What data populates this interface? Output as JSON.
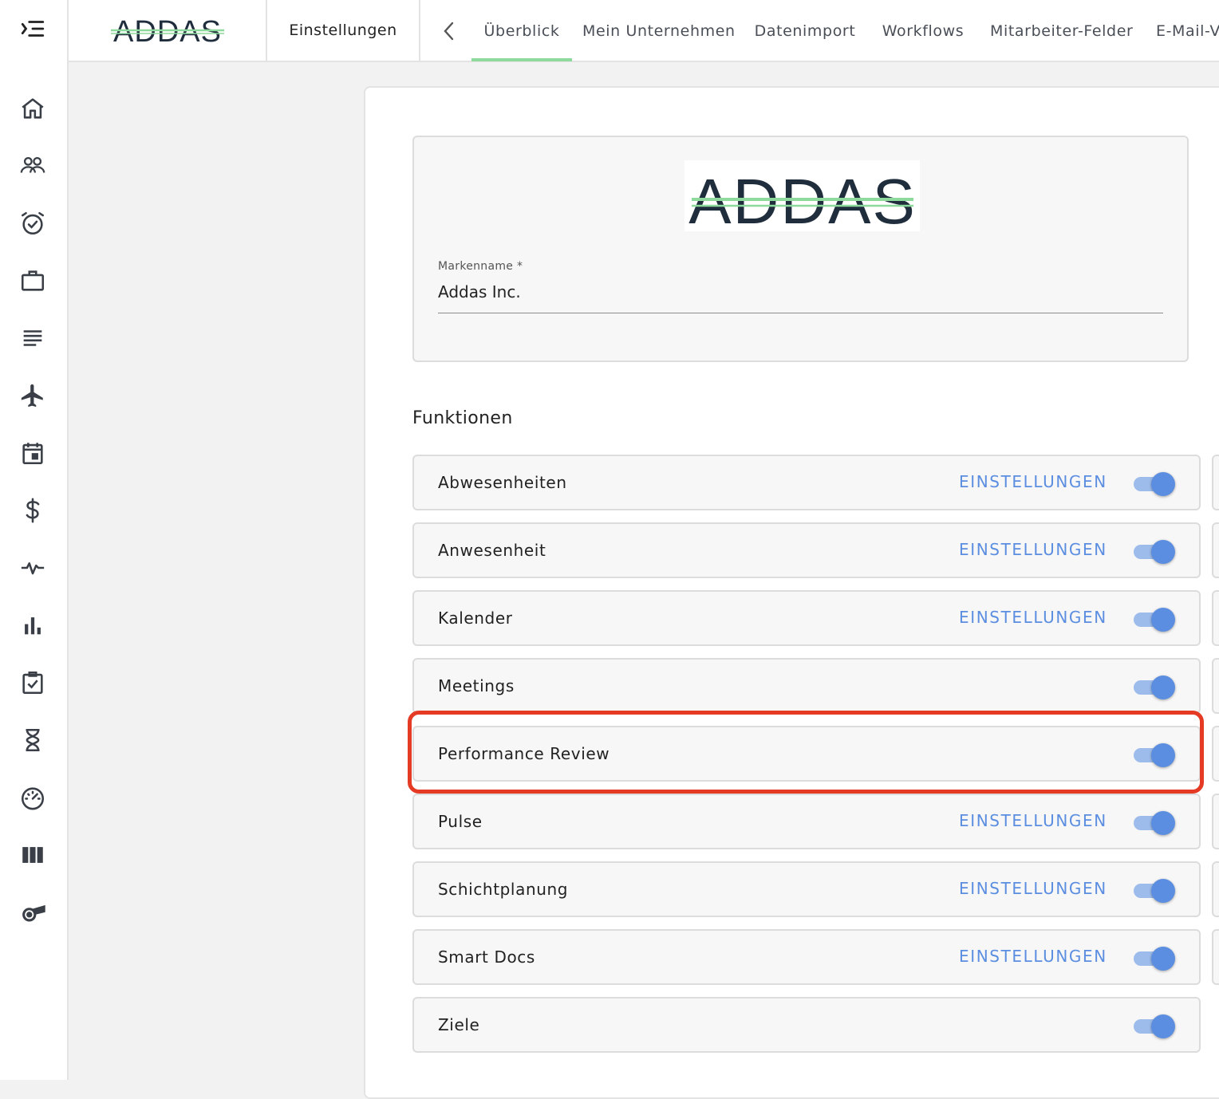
{
  "header": {
    "logo_text": "ADDAS",
    "section_label": "Einstellungen",
    "tabs": [
      {
        "label": "Überblick",
        "active": true
      },
      {
        "label": "Mein Unternehmen",
        "active": false
      },
      {
        "label": "Datenimport",
        "active": false
      },
      {
        "label": "Workflows",
        "active": false
      },
      {
        "label": "Mitarbeiter-Felder",
        "active": false
      },
      {
        "label": "E-Mail-V",
        "active": false
      }
    ]
  },
  "sidebar": {
    "icons": [
      "menu-collapse-icon",
      "home-icon",
      "people-icon",
      "alarm-clock-icon",
      "briefcase-icon",
      "list-icon",
      "airplane-icon",
      "calendar-icon",
      "dollar-icon",
      "pulse-icon",
      "bar-chart-icon",
      "checklist-icon",
      "hourglass-icon",
      "speedometer-icon",
      "columns-icon",
      "whistle-icon"
    ]
  },
  "brand": {
    "logo_text": "ADDAS",
    "field_label": "Markenname *",
    "field_value": "Addas Inc."
  },
  "features": {
    "title": "Funktionen",
    "settings_label": "EINSTELLUNGEN",
    "items": [
      {
        "name": "Abwesenheiten",
        "has_settings": true,
        "enabled": true
      },
      {
        "name": "Anwesenheit",
        "has_settings": true,
        "enabled": true
      },
      {
        "name": "Kalender",
        "has_settings": true,
        "enabled": true
      },
      {
        "name": "Meetings",
        "has_settings": false,
        "enabled": true
      },
      {
        "name": "Performance Review",
        "has_settings": false,
        "enabled": true
      },
      {
        "name": "Pulse",
        "has_settings": true,
        "enabled": true
      },
      {
        "name": "Schichtplanung",
        "has_settings": true,
        "enabled": true
      },
      {
        "name": "Smart Docs",
        "has_settings": true,
        "enabled": true
      },
      {
        "name": "Ziele",
        "has_settings": false,
        "enabled": true
      }
    ]
  },
  "colors": {
    "accent": "#5b8ee0",
    "tab_underline": "#8ed99c",
    "highlight": "#e53b25"
  }
}
